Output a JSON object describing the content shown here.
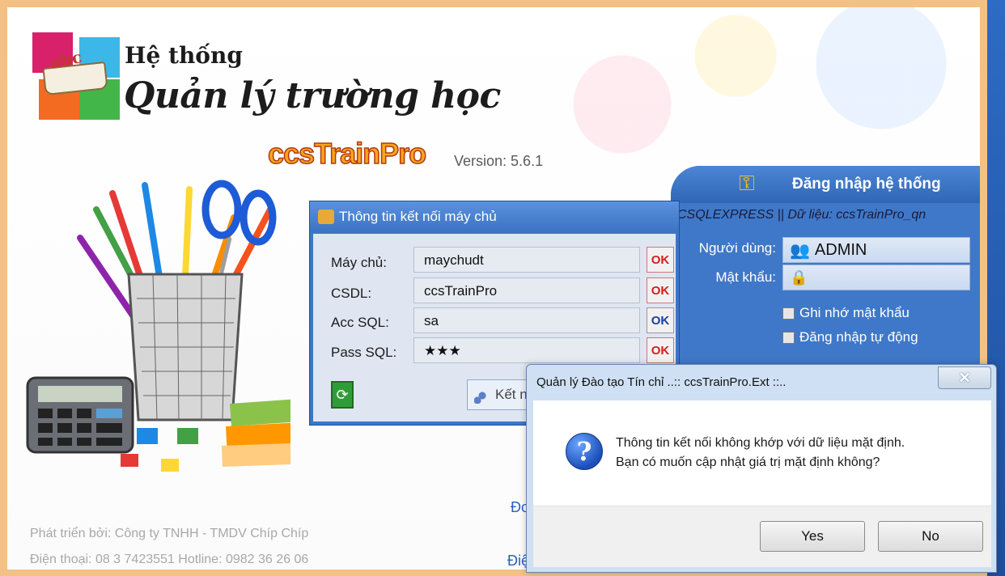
{
  "app": {
    "title_small": "Hệ thống",
    "title_big": "Quản lý trường học",
    "brand": "ccsTrainPro",
    "version": "Version: 5.6.1"
  },
  "login": {
    "title": "Đăng nhập hệ thống",
    "connection_info": "CSQLEXPRESS || Dữ liệu: ccsTrainPro_qn",
    "user_label": "Người dùng:",
    "user_value": "ADMIN",
    "password_label": "Mật khẩu:",
    "remember_password": "Ghi nhớ mật khẩu",
    "auto_login": "Đăng nhập tự động"
  },
  "server_dialog": {
    "title": "Thông tin kết nối máy chủ",
    "fields": [
      {
        "label": "Máy chủ:",
        "value": "maychudt",
        "ok": "OK",
        "ok_color": "red"
      },
      {
        "label": "CSDL:",
        "value": "ccsTrainPro",
        "ok": "OK",
        "ok_color": "red"
      },
      {
        "label": "Acc SQL:",
        "value": "sa",
        "ok": "OK",
        "ok_color": "blue"
      },
      {
        "label": "Pass SQL:",
        "value": "★★★",
        "ok": "OK",
        "ok_color": "red"
      }
    ],
    "connect_label": "Kết nố"
  },
  "footer": {
    "developer": "Phát triển bởi: Công ty TNHH - TMDV Chíp Chíp",
    "phone": "Điện thoại: 08 3 7423551 Hotline: 0982 36 26 06",
    "link1": "Đo",
    "link2": "Điệ"
  },
  "message_box": {
    "title": "Quản lý Đào tạo Tín chỉ ..:: ccsTrainPro.Ext ::..",
    "close_symbol": "✕",
    "line1": "Thông tin kết nối không khớp với dữ liệu mặt định.",
    "line2": "Bạn có muốn cập nhật giá trị mặt định không?",
    "yes_label": "Yes",
    "no_label": "No"
  },
  "colors": {
    "frame": "#f3c184",
    "panel_blue": "#3f78c8",
    "brand_orange": "#f7a51a"
  }
}
